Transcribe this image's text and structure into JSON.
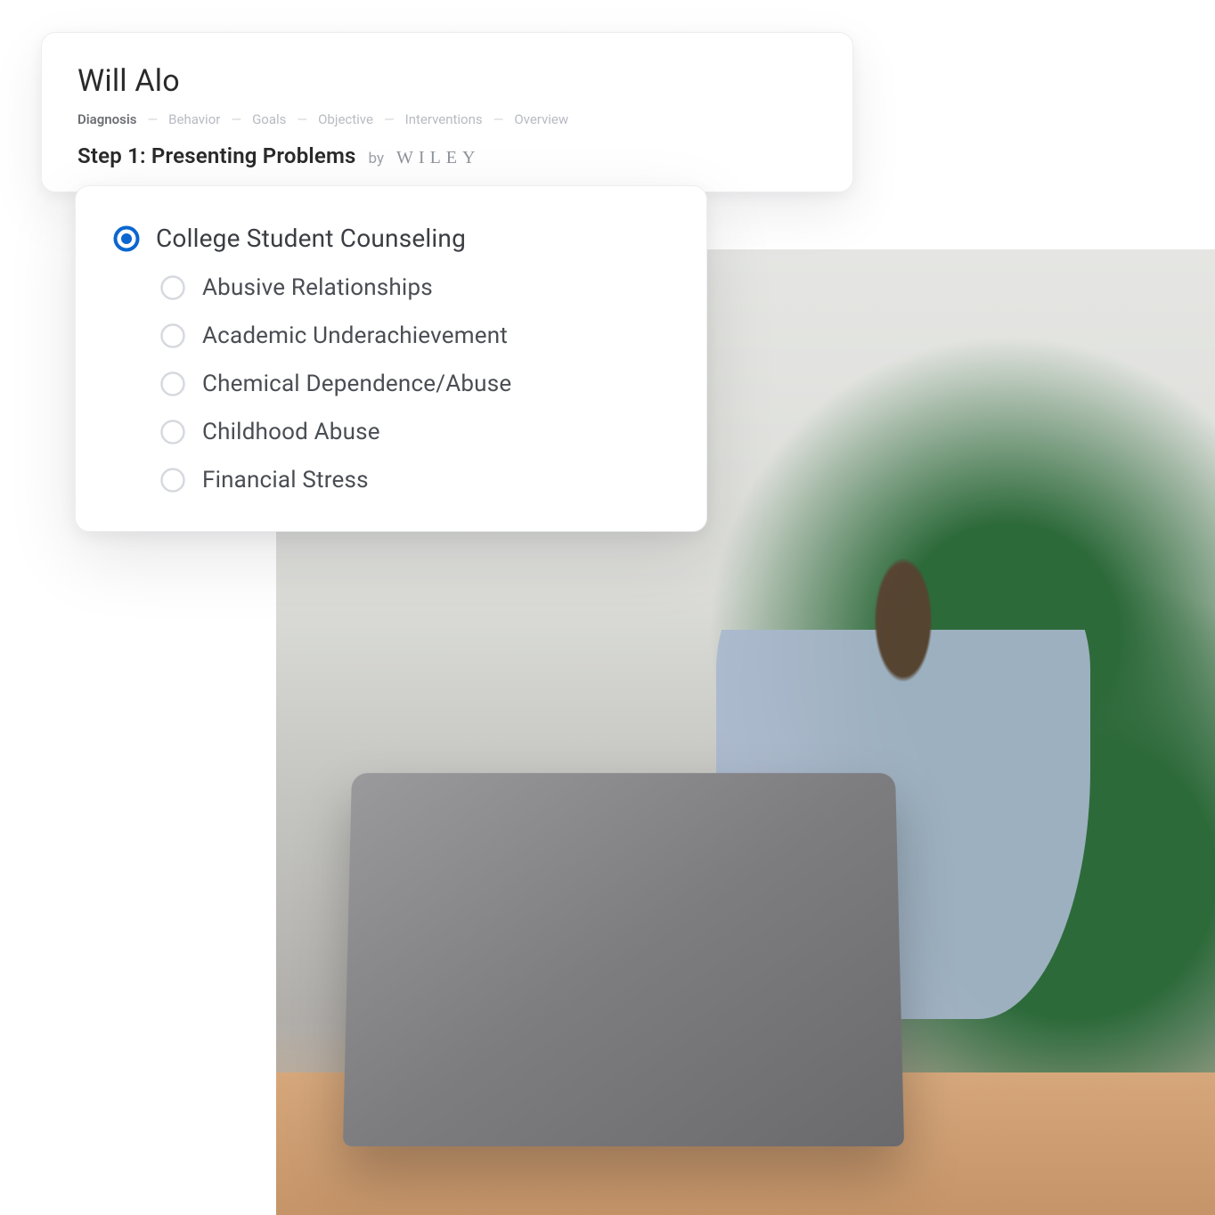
{
  "client_name": "Will Alo",
  "breadcrumb": {
    "items": [
      {
        "label": "Diagnosis",
        "active": true
      },
      {
        "label": "Behavior",
        "active": false
      },
      {
        "label": "Goals",
        "active": false
      },
      {
        "label": "Objective",
        "active": false
      },
      {
        "label": "Interventions",
        "active": false
      },
      {
        "label": "Overview",
        "active": false
      }
    ],
    "separator": "—"
  },
  "step": {
    "title": "Step 1: Presenting Problems",
    "by_label": "by",
    "brand": "WILEY"
  },
  "options": {
    "parent": {
      "label": "College Student Counseling",
      "selected": true
    },
    "children": [
      {
        "label": "Abusive Relationships",
        "selected": false
      },
      {
        "label": "Academic Underachievement",
        "selected": false
      },
      {
        "label": "Chemical Dependence/Abuse",
        "selected": false
      },
      {
        "label": "Childhood Abuse",
        "selected": false
      },
      {
        "label": "Financial Stress",
        "selected": false
      }
    ]
  },
  "colors": {
    "accent": "#0b66d0",
    "radio_ring": "#d6d9de"
  }
}
